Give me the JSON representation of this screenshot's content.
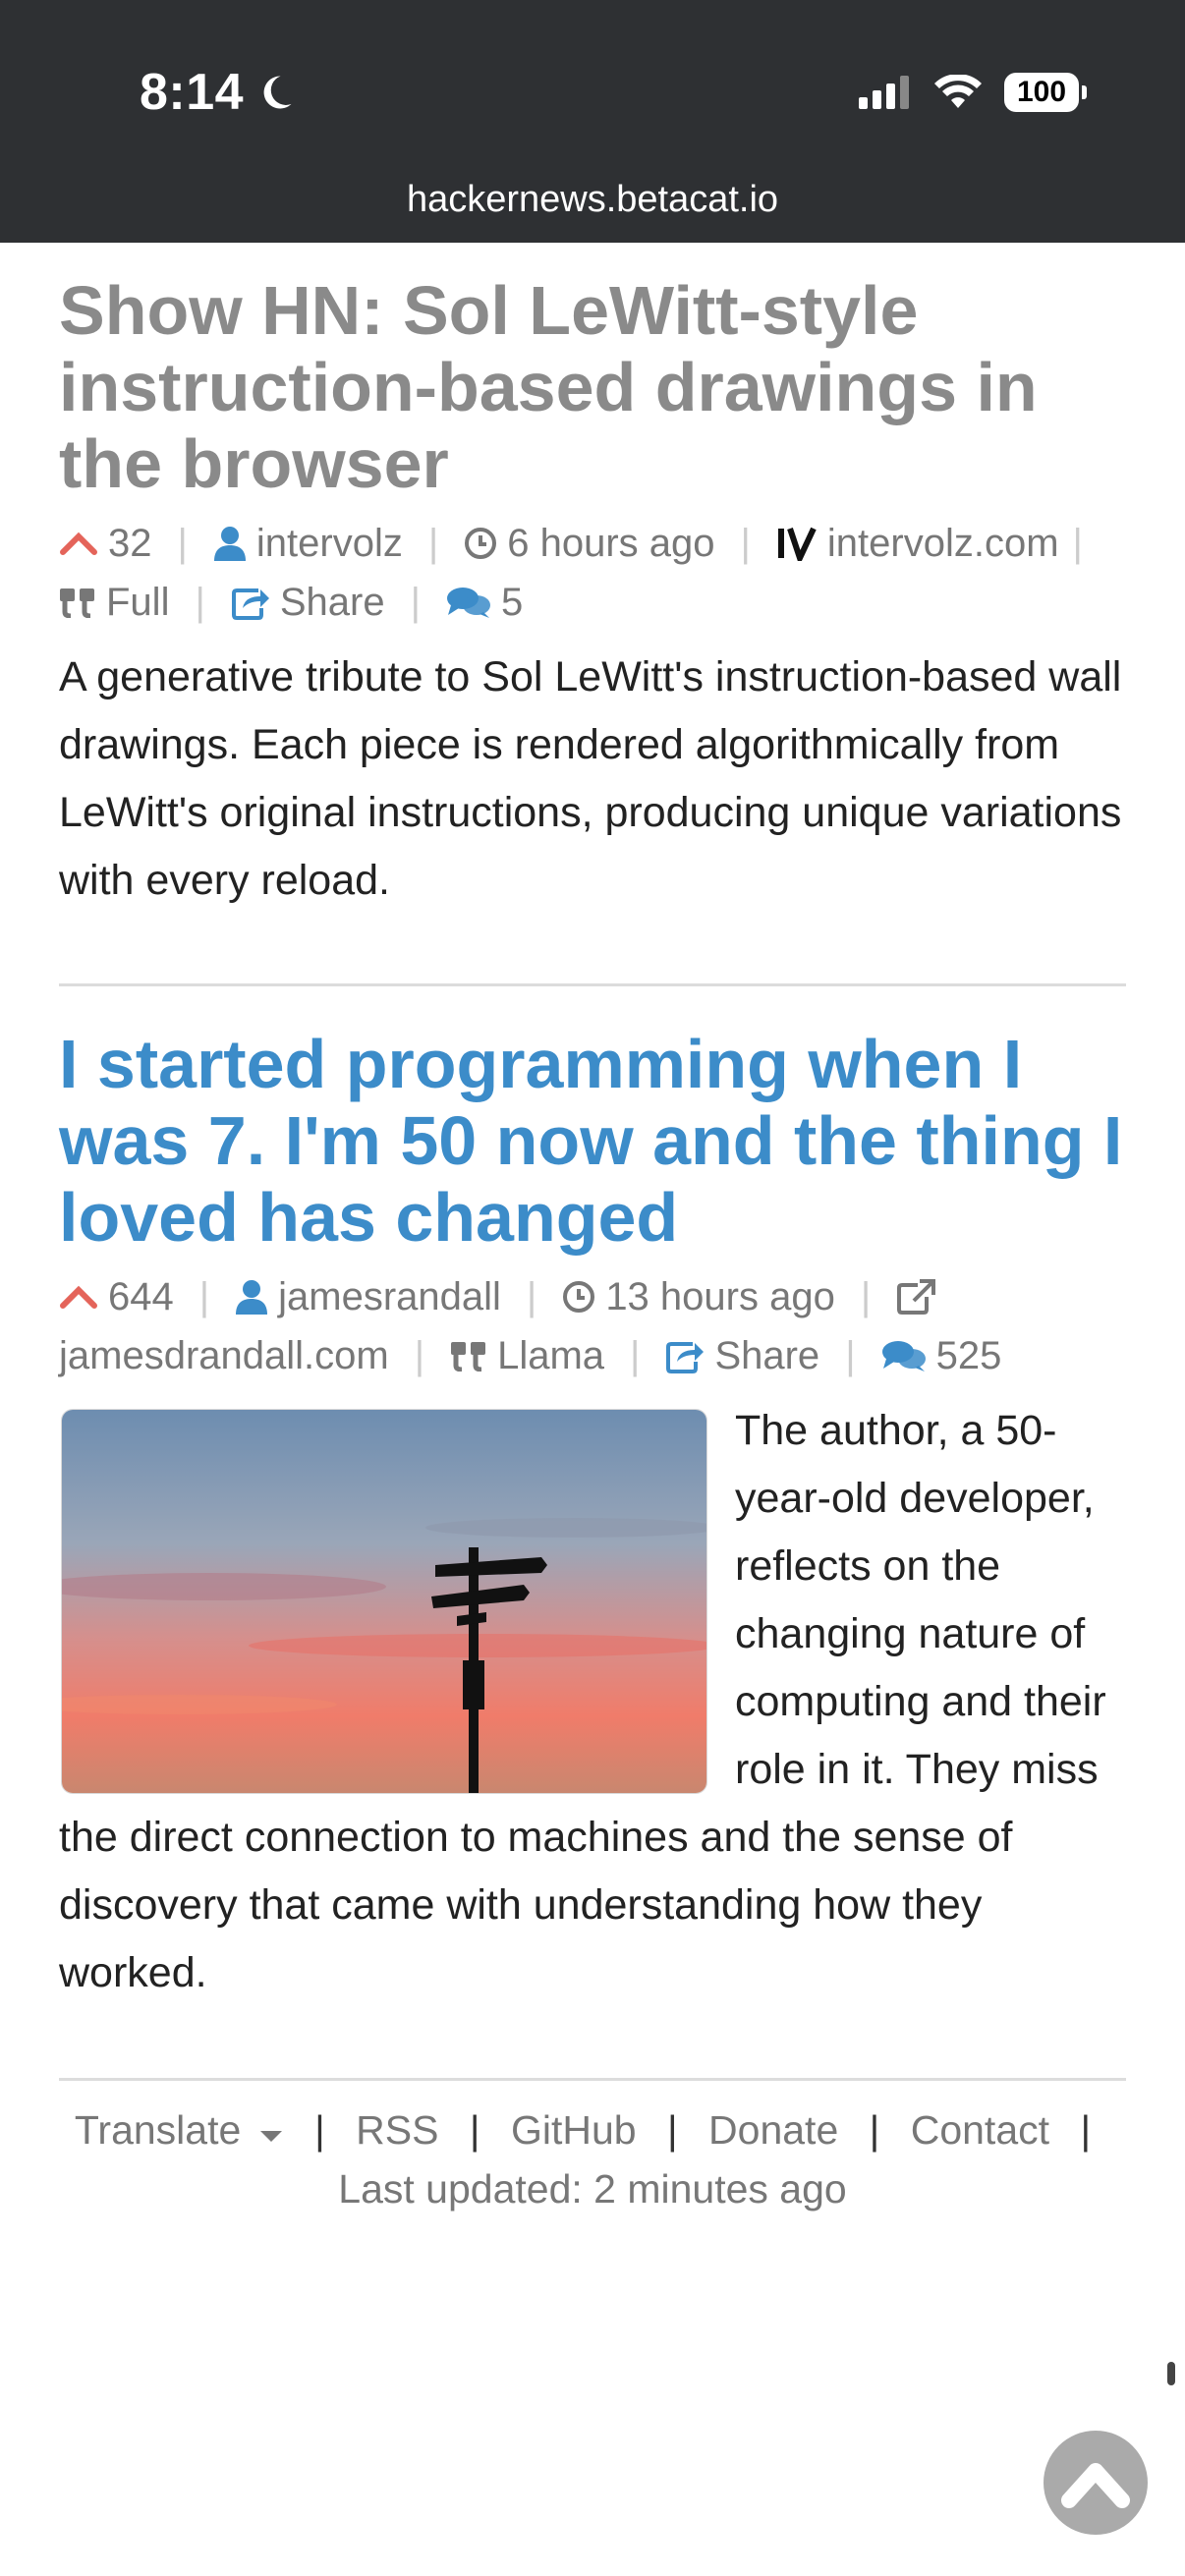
{
  "status_bar": {
    "time": "8:14",
    "battery": "100"
  },
  "browser": {
    "url": "hackernews.betacat.io"
  },
  "articles": [
    {
      "title": "Show HN: Sol LeWitt-style instruction-based drawings in the browser",
      "visited": true,
      "points": "32",
      "author": "intervolz",
      "age": "6 hours ago",
      "domain": "intervolz.com",
      "domain_icon": "intervolz-logo-icon",
      "full_label": "Full",
      "share_label": "Share",
      "comments": "5",
      "summary": "A generative tribute to Sol LeWitt's instruction-based wall drawings. Each piece is rendered algorithmically from LeWitt's original instructions, producing unique variations with every reload."
    },
    {
      "title": "I started programming when I was 7. I'm 50 now and the thing I loved has changed",
      "visited": false,
      "points": "644",
      "author": "jamesrandall",
      "age": "13 hours ago",
      "domain": "jamesdrandall.com",
      "domain_icon": "external-link-icon",
      "full_label": "Llama",
      "share_label": "Share",
      "comments": "525",
      "summary": "The author, a 50-year-old developer, reflects on the changing nature of computing and their role in it. They miss the direct connection to machines and the sense of discovery that came with understanding how they worked."
    }
  ],
  "footer": {
    "translate": "Translate",
    "rss": "RSS",
    "github": "GitHub",
    "donate": "Donate",
    "contact": "Contact",
    "last_updated": "Last updated: 2 minutes ago"
  },
  "colors": {
    "link": "#3c8cc9",
    "visited_title": "#8a8a8a",
    "upvote": "#e4645a",
    "topbar": "#2e3033"
  }
}
